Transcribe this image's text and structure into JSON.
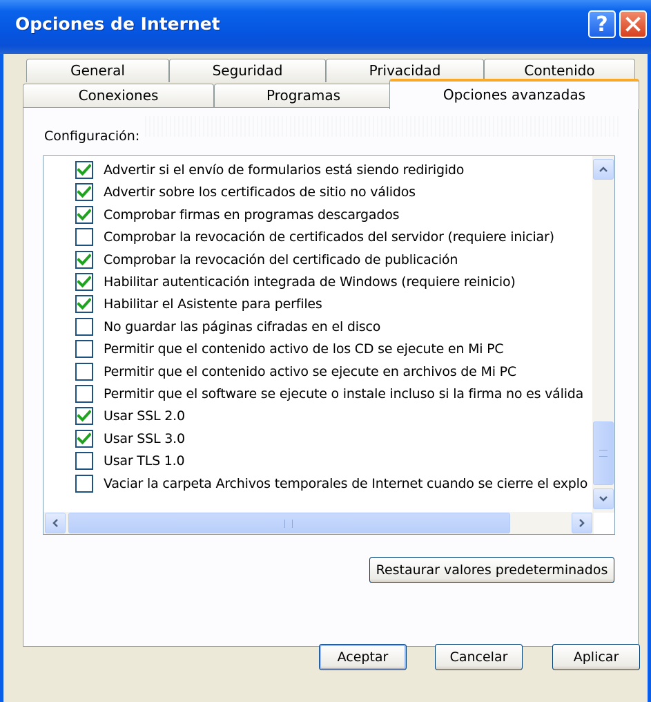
{
  "window": {
    "title": "Opciones de Internet",
    "help_icon": "question-mark",
    "close_icon": "x"
  },
  "tabs_row1": [
    {
      "label": "General"
    },
    {
      "label": "Seguridad"
    },
    {
      "label": "Privacidad"
    },
    {
      "label": "Contenido"
    }
  ],
  "tabs_row2": [
    {
      "label": "Conexiones"
    },
    {
      "label": "Programas"
    },
    {
      "label": "Opciones avanzadas",
      "active": true
    }
  ],
  "settings": {
    "label": "Configuración:",
    "items": [
      {
        "label": "Advertir si el envío de formularios está siendo redirigido",
        "checked": true
      },
      {
        "label": "Advertir sobre los certificados de sitio no válidos",
        "checked": true
      },
      {
        "label": "Comprobar firmas en programas descargados",
        "checked": true
      },
      {
        "label": "Comprobar la revocación de certificados del servidor (requiere iniciar)",
        "checked": false
      },
      {
        "label": "Comprobar la revocación del certificado de publicación",
        "checked": true
      },
      {
        "label": "Habilitar autenticación integrada de Windows (requiere reinicio)",
        "checked": true
      },
      {
        "label": "Habilitar el Asistente para perfiles",
        "checked": true
      },
      {
        "label": "No guardar las páginas cifradas en el disco",
        "checked": false
      },
      {
        "label": "Permitir que el contenido activo de los CD se ejecute en Mi PC",
        "checked": false
      },
      {
        "label": "Permitir que el contenido activo se ejecute en archivos de Mi PC",
        "checked": false
      },
      {
        "label": "Permitir que el software se ejecute o instale incluso si la firma no es válida",
        "checked": false
      },
      {
        "label": "Usar SSL 2.0",
        "checked": true
      },
      {
        "label": "Usar SSL 3.0",
        "checked": true
      },
      {
        "label": "Usar TLS 1.0",
        "checked": false
      },
      {
        "label": "Vaciar la carpeta Archivos temporales de Internet cuando se cierre el explo",
        "checked": false
      }
    ]
  },
  "buttons": {
    "restore": "Restaurar valores predeterminados",
    "ok": "Aceptar",
    "cancel": "Cancelar",
    "apply": "Aplicar"
  },
  "colors": {
    "titlebar": "#0555e0",
    "active_tab_accent": "#f6a92b",
    "checkmark": "#21a121"
  }
}
